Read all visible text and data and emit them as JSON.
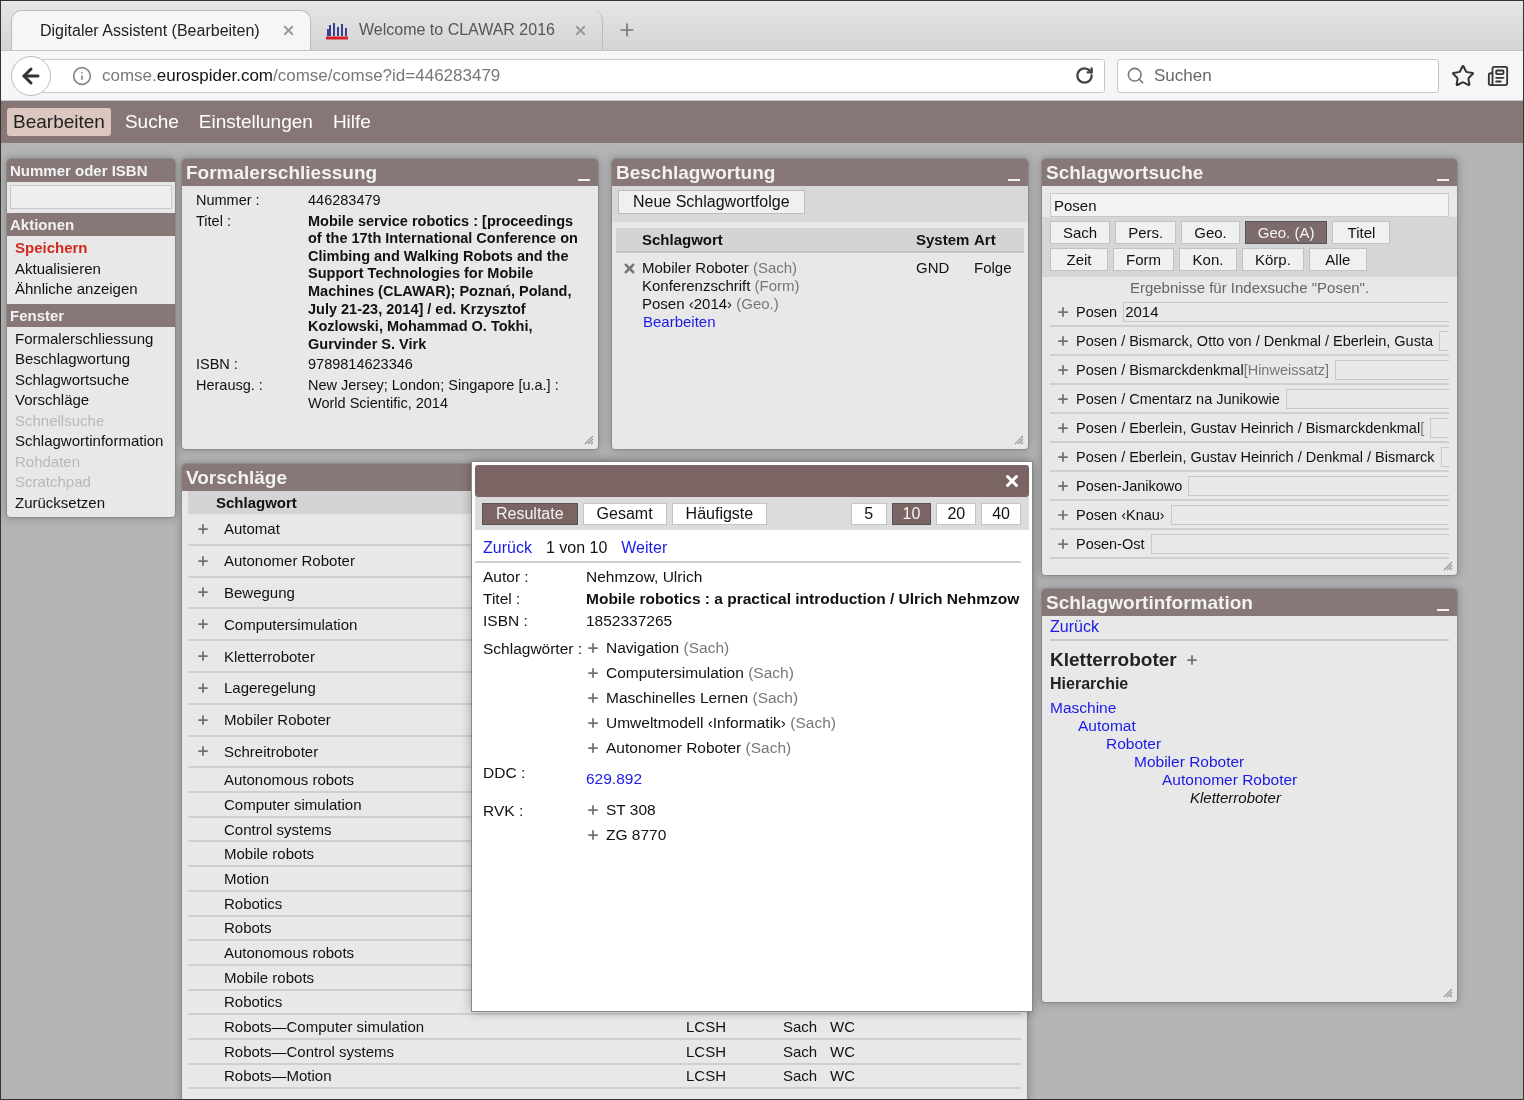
{
  "browser": {
    "tabs": [
      {
        "title": "Digitaler Assistent (Bearbeiten)",
        "selected": true,
        "favicon": false
      },
      {
        "title": "Welcome to CLAWAR 2016",
        "selected": false,
        "favicon": true
      }
    ],
    "url": {
      "prefix": "comse.",
      "domain": "eurospider.com",
      "path": "/comse/comse?id=446283479"
    },
    "search": {
      "placeholder": "Suchen"
    }
  },
  "menu": [
    {
      "label": "Bearbeiten",
      "selected": true
    },
    {
      "label": "Suche",
      "selected": false
    },
    {
      "label": "Einstellungen",
      "selected": false
    },
    {
      "label": "Hilfe",
      "selected": false
    }
  ],
  "sidebar": {
    "number_header": "Nummer oder ISBN",
    "sections": [
      {
        "title": "Aktionen",
        "items": [
          {
            "label": "Speichern",
            "highlighted": true,
            "disabled": false
          },
          {
            "label": "Aktualisieren",
            "highlighted": false,
            "disabled": false
          },
          {
            "label": "Ähnliche anzeigen",
            "highlighted": false,
            "disabled": false
          }
        ]
      },
      {
        "title": "Fenster",
        "items": [
          {
            "label": "Formalerschliessung",
            "highlighted": false,
            "disabled": false
          },
          {
            "label": "Beschlagwortung",
            "highlighted": false,
            "disabled": false
          },
          {
            "label": "Schlagwortsuche",
            "highlighted": false,
            "disabled": false
          },
          {
            "label": "Vorschläge",
            "highlighted": false,
            "disabled": false
          },
          {
            "label": "Schnellsuche",
            "highlighted": false,
            "disabled": true
          },
          {
            "label": "Schlagwortinformation",
            "highlighted": false,
            "disabled": false
          },
          {
            "label": "Rohdaten",
            "highlighted": false,
            "disabled": true
          },
          {
            "label": "Scratchpad",
            "highlighted": false,
            "disabled": true
          },
          {
            "label": "Zurücksetzen",
            "highlighted": false,
            "disabled": false
          }
        ]
      }
    ]
  },
  "formal": {
    "title": "Formalerschliessung",
    "fields": [
      {
        "label": "Nummer :",
        "value": "446283479",
        "bold": false
      },
      {
        "label": "Titel :",
        "value": "Mobile service robotics : [proceedings of the 17th International Conference on Climbing and Walking Robots and the Support Technologies for Mobile Machines (CLAWAR); Poznań, Poland, July 21-23, 2014] / ed. Krzysztof Kozlowski, Mohammad O. Tokhi, Gurvinder S. Virk",
        "bold": true
      },
      {
        "label": "ISBN :",
        "value": "9789814623346",
        "bold": false
      },
      {
        "label": "Herausg. :",
        "value": "New Jersey; London; Singapore [u.a.] : World Scientific, 2014",
        "bold": false
      }
    ]
  },
  "beschlagwortung": {
    "title": "Beschlagwortung",
    "new_button": "Neue Schlagwortfolge",
    "columns": [
      "Schlagwort",
      "System",
      "Art"
    ],
    "rows": [
      {
        "terms": [
          {
            "name": "Mobiler Roboter",
            "type": "(Sach)"
          },
          {
            "name": "Konferenzschrift",
            "type": "(Form)"
          },
          {
            "name": "Posen ‹2014›",
            "type": "(Geo.)"
          }
        ],
        "system": "GND",
        "art": "Folge",
        "edit_link": "Bearbeiten"
      }
    ]
  },
  "schlagwortsuche": {
    "title": "Schlagwortsuche",
    "query": "Posen",
    "filters": [
      {
        "label": "Sach",
        "selected": false
      },
      {
        "label": "Pers.",
        "selected": false
      },
      {
        "label": "Geo.",
        "selected": false
      },
      {
        "label": "Geo. (A)",
        "selected": true
      },
      {
        "label": "Titel",
        "selected": false
      },
      {
        "label": "Zeit",
        "selected": false
      },
      {
        "label": "Form",
        "selected": false
      },
      {
        "label": "Kon.",
        "selected": false
      },
      {
        "label": "Körp.",
        "selected": false
      },
      {
        "label": "Alle",
        "selected": false
      }
    ],
    "result_note": "Ergebnisse für Indexsuche \"Posen\".",
    "results": [
      {
        "term": "Posen",
        "field_value": "2014"
      },
      {
        "term": "Posen / Bismarck, Otto von / Denkmal / Eberlein, Gusta"
      },
      {
        "term": "Posen / Bismarckdenkmal",
        "note": "[Hinweissatz]"
      },
      {
        "term": "Posen / Cmentarz na Junikowie"
      },
      {
        "term": "Posen / Eberlein, Gustav Heinrich / Bismarckdenkmal",
        "note": "["
      },
      {
        "term": "Posen / Eberlein, Gustav Heinrich / Denkmal / Bismarck"
      },
      {
        "term": "Posen-Janikowo"
      },
      {
        "term": "Posen ‹Knau›"
      },
      {
        "term": "Posen-Ost"
      }
    ]
  },
  "vorschlaege": {
    "title": "Vorschläge",
    "columns": [
      "Schlagwort"
    ],
    "rows": [
      {
        "term": "Automat",
        "kind": "expandable"
      },
      {
        "term": "Autonomer Roboter",
        "kind": "expandable"
      },
      {
        "term": "Bewegung",
        "kind": "expandable"
      },
      {
        "term": "Computersimulation",
        "kind": "expandable"
      },
      {
        "term": "Kletterroboter",
        "kind": "expandable"
      },
      {
        "term": "Lageregelung",
        "kind": "expandable"
      },
      {
        "term": "Mobiler Roboter",
        "kind": "expandable"
      },
      {
        "term": "Schreitroboter",
        "kind": "expandable"
      },
      {
        "term": "Autonomous robots",
        "kind": "plain"
      },
      {
        "term": "Computer simulation",
        "kind": "plain"
      },
      {
        "term": "Control systems",
        "kind": "plain"
      },
      {
        "term": "Mobile robots",
        "kind": "plain"
      },
      {
        "term": "Motion",
        "kind": "plain"
      },
      {
        "term": "Robotics",
        "kind": "plain"
      },
      {
        "term": "Robots",
        "kind": "plain"
      },
      {
        "term": "Autonomous robots",
        "kind": "plain"
      },
      {
        "term": "Mobile robots",
        "kind": "plain"
      },
      {
        "term": "Robotics",
        "kind": "plain"
      },
      {
        "term": "Robots—Computer simulation",
        "kind": "plain",
        "system": "LCSH",
        "type": "Sach",
        "source": "WC"
      },
      {
        "term": "Robots—Control systems",
        "kind": "plain",
        "system": "LCSH",
        "type": "Sach",
        "source": "WC"
      },
      {
        "term": "Robots—Motion",
        "kind": "plain",
        "system": "LCSH",
        "type": "Sach",
        "source": "WC"
      }
    ]
  },
  "popup": {
    "tabs": [
      {
        "label": "Resultate",
        "selected": true
      },
      {
        "label": "Gesamt",
        "selected": false
      },
      {
        "label": "Häufigste",
        "selected": false
      }
    ],
    "page_sizes": [
      {
        "label": "5",
        "selected": false
      },
      {
        "label": "10",
        "selected": true
      },
      {
        "label": "20",
        "selected": false
      },
      {
        "label": "40",
        "selected": false
      }
    ],
    "nav": {
      "back": "Zurück",
      "position": "1 von 10",
      "next": "Weiter"
    },
    "fields": [
      {
        "label": "Autor :",
        "kind": "text",
        "value": "Nehmzow, Ulrich"
      },
      {
        "label": "Titel :",
        "kind": "title",
        "value": "Mobile robotics : a practical introduction / Ulrich Nehmzow"
      },
      {
        "label": "ISBN :",
        "kind": "text",
        "value": "1852337265"
      },
      {
        "label": "Schlagwörter :",
        "kind": "terms",
        "items": [
          {
            "name": "Navigation",
            "type": "(Sach)"
          },
          {
            "name": "Computersimulation",
            "type": "(Sach)"
          },
          {
            "name": "Maschinelles Lernen",
            "type": "(Sach)"
          },
          {
            "name": "Umweltmodell ‹Informatik›",
            "type": "(Sach)"
          },
          {
            "name": "Autonomer Roboter",
            "type": "(Sach)"
          }
        ]
      },
      {
        "label": "DDC :",
        "kind": "link",
        "value": "629.892"
      },
      {
        "label": "RVK :",
        "kind": "terms",
        "items": [
          {
            "name": "ST 308"
          },
          {
            "name": "ZG 8770"
          }
        ]
      }
    ]
  },
  "info": {
    "title": "Schlagwortinformation",
    "back": "Zurück",
    "term": "Kletterroboter",
    "hierarchy_title": "Hierarchie",
    "hierarchy": [
      {
        "label": "Maschine",
        "current": false,
        "children": [
          {
            "label": "Automat",
            "current": false,
            "children": [
              {
                "label": "Roboter",
                "current": false,
                "children": [
                  {
                    "label": "Mobiler Roboter",
                    "current": false,
                    "children": [
                      {
                        "label": "Autonomer Roboter",
                        "current": false,
                        "children": [
                          {
                            "label": "Kletterroboter",
                            "current": true
                          }
                        ]
                      }
                    ]
                  }
                ]
              }
            ]
          }
        ]
      }
    ]
  }
}
